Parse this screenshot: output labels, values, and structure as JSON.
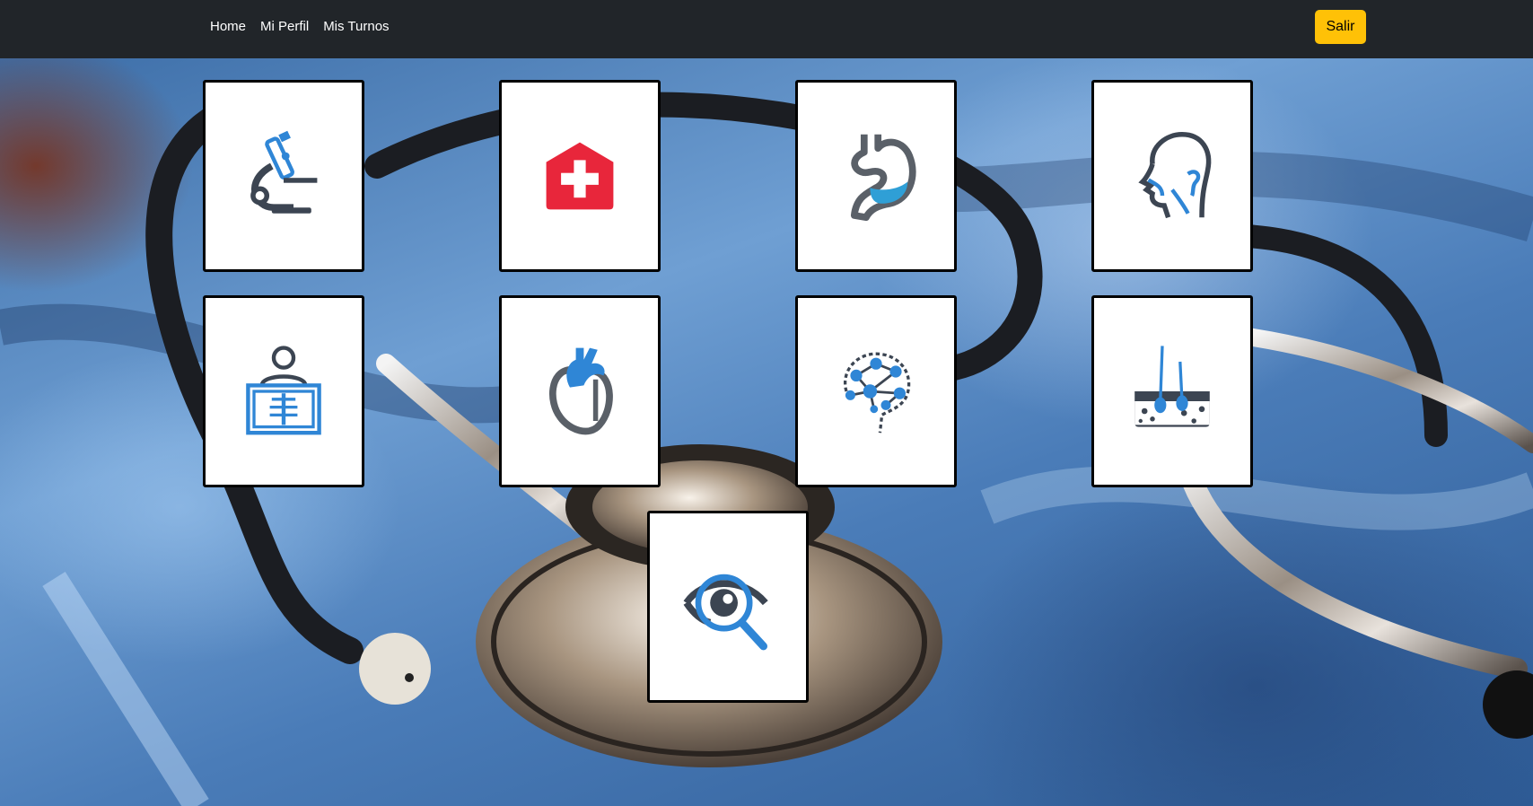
{
  "nav": {
    "links": [
      "Home",
      "Mi Perfil",
      "Mis Turnos"
    ],
    "logout_label": "Salir"
  },
  "specialty_icons": [
    "microscope-icon",
    "medical-plus-icon",
    "stomach-icon",
    "head-profile-icon",
    "xray-icon",
    "heart-icon",
    "brain-network-icon",
    "skin-hair-icon",
    "eye-magnifier-icon"
  ],
  "colors": {
    "navbar": "#212529",
    "logout_button": "#ffc107",
    "icon_blue": "#2f86d6",
    "icon_dark": "#3c4552",
    "icon_red": "#e8263b"
  }
}
